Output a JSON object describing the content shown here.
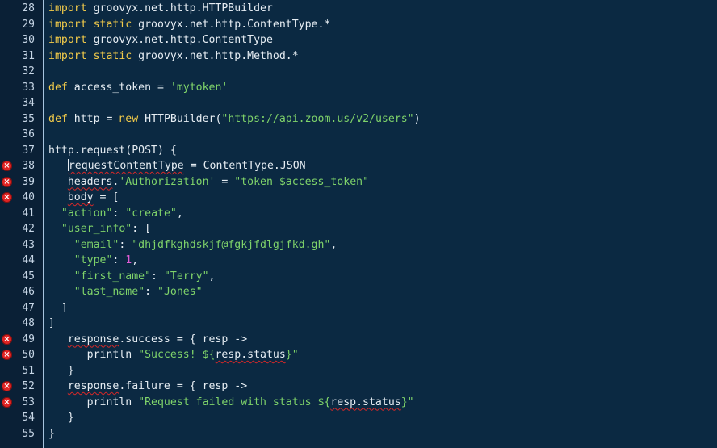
{
  "editor": {
    "colors": {
      "background": "#0b2942",
      "keyword": "#f2cb4a",
      "string": "#7fd36a",
      "number": "#e25bd6",
      "error": "#e02424"
    },
    "lines": [
      {
        "n": "28",
        "err": false,
        "indent": 0,
        "tokens": [
          {
            "t": "import",
            "c": "kw"
          },
          {
            "t": " groovyx.net.http.HTTPBuilder",
            "c": "txt"
          }
        ]
      },
      {
        "n": "29",
        "err": false,
        "indent": 0,
        "tokens": [
          {
            "t": "import",
            "c": "kw"
          },
          {
            "t": " ",
            "c": "txt"
          },
          {
            "t": "static",
            "c": "kw"
          },
          {
            "t": " groovyx.net.http.ContentType.*",
            "c": "txt"
          }
        ]
      },
      {
        "n": "30",
        "err": false,
        "indent": 0,
        "tokens": [
          {
            "t": "import",
            "c": "kw"
          },
          {
            "t": " groovyx.net.http.ContentType",
            "c": "txt"
          }
        ]
      },
      {
        "n": "31",
        "err": false,
        "indent": 0,
        "tokens": [
          {
            "t": "import",
            "c": "kw"
          },
          {
            "t": " ",
            "c": "txt"
          },
          {
            "t": "static",
            "c": "kw"
          },
          {
            "t": " groovyx.net.http.Method.*",
            "c": "txt"
          }
        ]
      },
      {
        "n": "32",
        "err": false,
        "indent": 0,
        "tokens": []
      },
      {
        "n": "33",
        "err": false,
        "indent": 0,
        "tokens": [
          {
            "t": "def",
            "c": "kw"
          },
          {
            "t": " access_token = ",
            "c": "txt"
          },
          {
            "t": "'mytoken'",
            "c": "str"
          }
        ]
      },
      {
        "n": "34",
        "err": false,
        "indent": 0,
        "tokens": []
      },
      {
        "n": "35",
        "err": false,
        "indent": 0,
        "tokens": [
          {
            "t": "def",
            "c": "kw"
          },
          {
            "t": " http = ",
            "c": "txt"
          },
          {
            "t": "new",
            "c": "kw"
          },
          {
            "t": " HTTPBuilder(",
            "c": "txt"
          },
          {
            "t": "\"https://api.zoom.us/v2/users\"",
            "c": "str"
          },
          {
            "t": ")",
            "c": "txt"
          }
        ]
      },
      {
        "n": "36",
        "err": false,
        "indent": 0,
        "tokens": []
      },
      {
        "n": "37",
        "err": false,
        "indent": 0,
        "tokens": [
          {
            "t": "http.request(POST) {",
            "c": "txt"
          }
        ]
      },
      {
        "n": "38",
        "err": true,
        "indent": 3,
        "caret": true,
        "tokens": [
          {
            "t": "requestContentType",
            "c": "txt",
            "sq": true
          },
          {
            "t": " = ContentType.JSON",
            "c": "txt"
          }
        ]
      },
      {
        "n": "39",
        "err": true,
        "indent": 3,
        "tokens": [
          {
            "t": "headers",
            "c": "txt",
            "sq": true
          },
          {
            "t": ".",
            "c": "txt"
          },
          {
            "t": "'Authorization'",
            "c": "str"
          },
          {
            "t": " = ",
            "c": "txt"
          },
          {
            "t": "\"token $access_token\"",
            "c": "str"
          }
        ]
      },
      {
        "n": "40",
        "err": true,
        "indent": 3,
        "tokens": [
          {
            "t": "body",
            "c": "txt",
            "sq": true
          },
          {
            "t": " = [",
            "c": "txt"
          }
        ]
      },
      {
        "n": "41",
        "err": false,
        "indent": 2,
        "tokens": [
          {
            "t": "\"action\"",
            "c": "str"
          },
          {
            "t": ": ",
            "c": "txt"
          },
          {
            "t": "\"create\"",
            "c": "str"
          },
          {
            "t": ",",
            "c": "txt"
          }
        ]
      },
      {
        "n": "42",
        "err": false,
        "indent": 2,
        "tokens": [
          {
            "t": "\"user_info\"",
            "c": "str"
          },
          {
            "t": ": [",
            "c": "txt"
          }
        ]
      },
      {
        "n": "43",
        "err": false,
        "indent": 4,
        "tokens": [
          {
            "t": "\"email\"",
            "c": "str"
          },
          {
            "t": ": ",
            "c": "txt"
          },
          {
            "t": "\"dhjdfkghdskjf@fgkjfdlgjfkd.gh\"",
            "c": "str"
          },
          {
            "t": ",",
            "c": "txt"
          }
        ]
      },
      {
        "n": "44",
        "err": false,
        "indent": 4,
        "tokens": [
          {
            "t": "\"type\"",
            "c": "str"
          },
          {
            "t": ": ",
            "c": "txt"
          },
          {
            "t": "1",
            "c": "num"
          },
          {
            "t": ",",
            "c": "txt"
          }
        ]
      },
      {
        "n": "45",
        "err": false,
        "indent": 4,
        "tokens": [
          {
            "t": "\"first_name\"",
            "c": "str"
          },
          {
            "t": ": ",
            "c": "txt"
          },
          {
            "t": "\"Terry\"",
            "c": "str"
          },
          {
            "t": ",",
            "c": "txt"
          }
        ]
      },
      {
        "n": "46",
        "err": false,
        "indent": 4,
        "tokens": [
          {
            "t": "\"last_name\"",
            "c": "str"
          },
          {
            "t": ": ",
            "c": "txt"
          },
          {
            "t": "\"Jones\"",
            "c": "str"
          }
        ]
      },
      {
        "n": "47",
        "err": false,
        "indent": 2,
        "tokens": [
          {
            "t": "]",
            "c": "txt"
          }
        ]
      },
      {
        "n": "48",
        "err": false,
        "indent": 0,
        "tokens": [
          {
            "t": "]",
            "c": "txt"
          }
        ]
      },
      {
        "n": "49",
        "err": true,
        "indent": 3,
        "tokens": [
          {
            "t": "response",
            "c": "txt",
            "sq": true
          },
          {
            "t": ".success = { resp ->",
            "c": "txt"
          }
        ]
      },
      {
        "n": "50",
        "err": true,
        "indent": 6,
        "tokens": [
          {
            "t": "println ",
            "c": "txt"
          },
          {
            "t": "\"Success! ${",
            "c": "str"
          },
          {
            "t": "resp.status",
            "c": "txt",
            "sq": true
          },
          {
            "t": "}\"",
            "c": "str"
          }
        ]
      },
      {
        "n": "51",
        "err": false,
        "indent": 3,
        "tokens": [
          {
            "t": "}",
            "c": "txt"
          }
        ]
      },
      {
        "n": "52",
        "err": true,
        "indent": 3,
        "tokens": [
          {
            "t": "response",
            "c": "txt",
            "sq": true
          },
          {
            "t": ".failure = { resp ->",
            "c": "txt"
          }
        ]
      },
      {
        "n": "53",
        "err": true,
        "indent": 6,
        "tokens": [
          {
            "t": "println ",
            "c": "txt"
          },
          {
            "t": "\"Request failed with status ${",
            "c": "str"
          },
          {
            "t": "resp.status",
            "c": "txt",
            "sq": true
          },
          {
            "t": "}\"",
            "c": "str"
          }
        ]
      },
      {
        "n": "54",
        "err": false,
        "indent": 3,
        "tokens": [
          {
            "t": "}",
            "c": "txt"
          }
        ]
      },
      {
        "n": "55",
        "err": false,
        "indent": 0,
        "tokens": [
          {
            "t": "}",
            "c": "txt"
          }
        ]
      }
    ]
  }
}
